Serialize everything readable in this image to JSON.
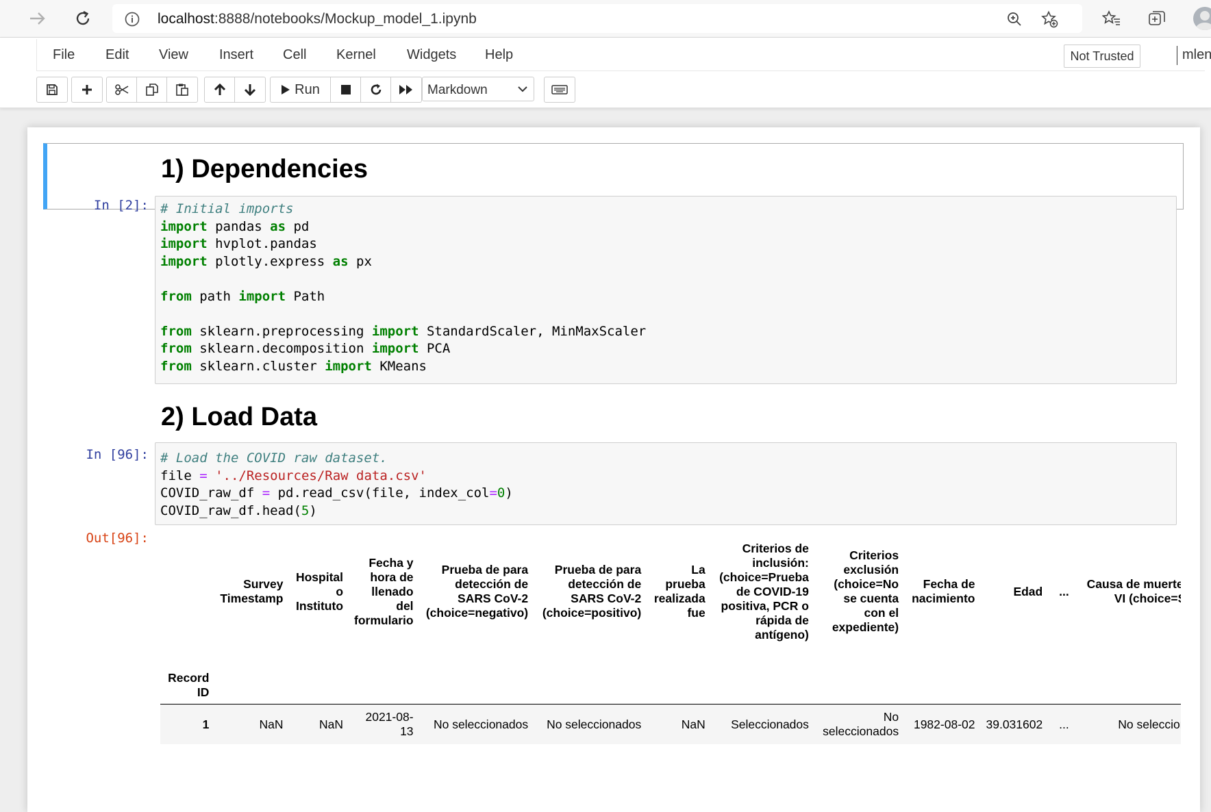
{
  "browser": {
    "url_host": "localhost",
    "url_path": ":8888/notebooks/Mockup_model_1.ipynb"
  },
  "menubar": {
    "items": [
      "File",
      "Edit",
      "View",
      "Insert",
      "Cell",
      "Kernel",
      "Widgets",
      "Help"
    ],
    "trust_status": "Not Trusted",
    "kernel_name": "mlenv"
  },
  "toolbar": {
    "run_label": "Run",
    "cell_type": "Markdown"
  },
  "cells": {
    "heading1": "1) Dependencies",
    "cell1_prompt": "In [2]:",
    "heading2": "2) Load Data",
    "cell2_prompt": "In [96]:",
    "out_prompt": "Out[96]:"
  },
  "code1": {
    "l1": "# Initial imports",
    "l2_kw": "import",
    "l2_rest": " pandas ",
    "l2_kw2": "as",
    "l2_end": " pd",
    "l3_kw": "import",
    "l3_rest": " hvplot.pandas",
    "l4_kw": "import",
    "l4_rest": " plotly.express ",
    "l4_kw2": "as",
    "l4_end": " px",
    "l6_kw": "from",
    "l6_rest": " path ",
    "l6_kw2": "import",
    "l6_end": " Path",
    "l8_kw": "from",
    "l8_rest": " sklearn.preprocessing ",
    "l8_kw2": "import",
    "l8_end": " StandardScaler, MinMaxScaler",
    "l9_kw": "from",
    "l9_rest": " sklearn.decomposition ",
    "l9_kw2": "import",
    "l9_end": " PCA",
    "l10_kw": "from",
    "l10_rest": " sklearn.cluster ",
    "l10_kw2": "import",
    "l10_end": " KMeans"
  },
  "code2": {
    "l1": "# Load the COVID raw dataset.",
    "l2_a": "file ",
    "l2_op": "=",
    "l2_sp": " ",
    "l2_str": "'../Resources/Raw data.csv'",
    "l3_a": "COVID_raw_df ",
    "l3_op": "=",
    "l3_b": " pd.read_csv(file, index_col",
    "l3_op2": "=",
    "l3_num": "0",
    "l3_c": ")",
    "l4_a": "COVID_raw_df.head(",
    "l4_num": "5",
    "l4_c": ")"
  },
  "dataframe": {
    "columns": [
      "Survey Timestamp",
      "Hospital o Instituto",
      "Fecha y hora de llenado del formulario",
      "Prueba de para detección de SARS CoV-2 (choice=negativo)",
      "Prueba de para detección de SARS CoV-2 (choice=positivo)",
      "La prueba realizada fue",
      "Criterios de inclusión: (choice=Prueba de COVID-19 positiva, PCR o rápida de antígeno)",
      "Criterios exclusión (choice=No se cuenta con el expediente)",
      "Fecha de nacimiento",
      "Edad",
      "...",
      "Causa de muerte durante la VI (choice=Sepsis"
    ],
    "index_name": "Record ID",
    "rows": [
      {
        "index": "1",
        "values": [
          "NaN",
          "NaN",
          "2021-08-13",
          "No seleccionados",
          "No seleccionados",
          "NaN",
          "Seleccionados",
          "No seleccionados",
          "1982-08-02",
          "39.031602",
          "...",
          "No seleccionados"
        ]
      }
    ]
  }
}
